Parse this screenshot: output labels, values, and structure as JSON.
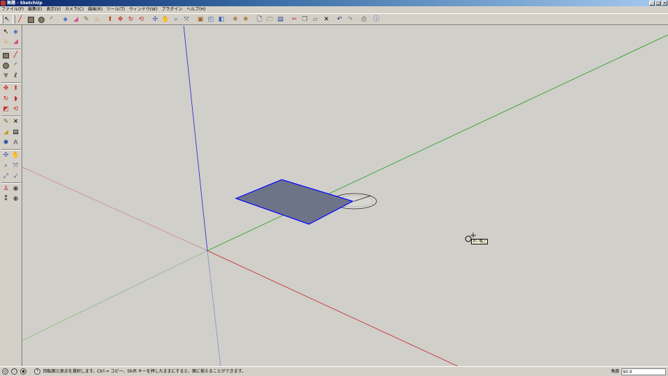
{
  "window": {
    "title": "無題 - SketchUp"
  },
  "menu": {
    "items": [
      "ファイル(F)",
      "編集(E)",
      "表示(V)",
      "カメラ(C)",
      "描画(R)",
      "ツール(T)",
      "ウィンドウ(W)",
      "プラグイン",
      "ヘルプ(H)"
    ]
  },
  "colors": {
    "viewport": "#d0cfca",
    "x_axis": "#cc2020",
    "y_axis": "#20a020",
    "z_axis": "#2020cc",
    "face": "#6e7488",
    "face_edge": "#0000ff"
  },
  "toolbar": {
    "icons": [
      "select-icon",
      "line-icon",
      "rectangle-icon",
      "circle-icon",
      "arc-icon",
      "make-component-icon",
      "eraser-icon",
      "tape-measure-icon",
      "paint-bucket-icon",
      "push-pull-icon",
      "move-icon",
      "rotate-icon",
      "offset-icon",
      "orbit-icon",
      "pan-icon",
      "zoom-icon",
      "zoom-extents-icon",
      "iso-view-icon",
      "top-view-icon",
      "front-view-icon",
      "right-view-icon",
      "xray-icon",
      "wireframe-icon",
      "new-icon",
      "open-icon",
      "save-icon",
      "cut-icon",
      "copy-icon",
      "paste-icon",
      "delete-icon",
      "undo-icon",
      "redo-icon",
      "print-icon",
      "model-info-icon"
    ]
  },
  "tools": {
    "icons": [
      "select-icon",
      "make-component-icon",
      "paint-bucket-icon",
      "eraser-icon",
      "rectangle-icon",
      "line-icon",
      "circle-icon",
      "arc-icon",
      "polygon-icon",
      "freehand-icon",
      "move-icon",
      "push-pull-icon",
      "rotate-icon",
      "follow-me-icon",
      "scale-icon",
      "offset-icon",
      "tape-measure-icon",
      "dimension-icon",
      "protractor-icon",
      "text-icon",
      "axes-icon",
      "3d-text-icon",
      "orbit-icon",
      "pan-icon",
      "zoom-icon",
      "zoom-window-icon",
      "zoom-extents-icon",
      "previous-view-icon",
      "position-camera-icon",
      "look-around-icon",
      "walk-icon",
      "section-plane-icon"
    ]
  },
  "viewport": {
    "cursor_tooltip": "赤い軸上"
  },
  "status": {
    "message": "回転面と原点を選択します。Ctrl = コピー、Shift キーを押したままにすると、面に揃えることができます。",
    "value_label": "角度",
    "value": "90.0"
  }
}
